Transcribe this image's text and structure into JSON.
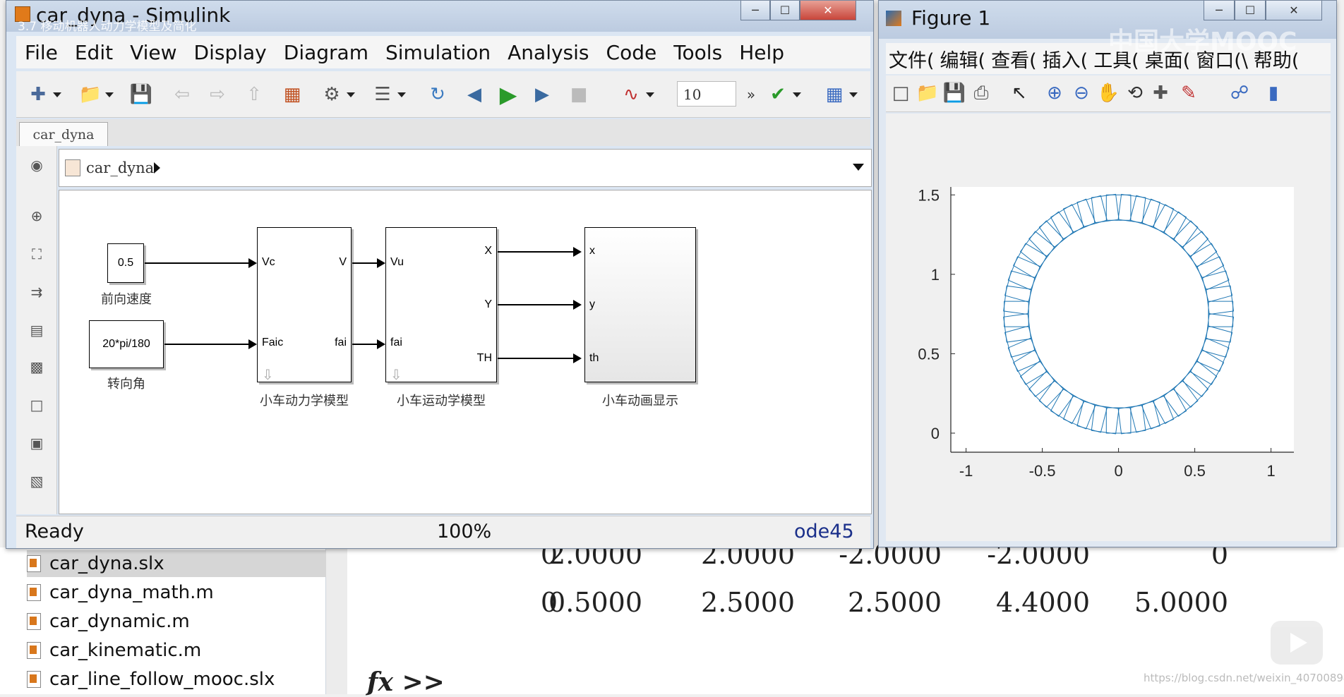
{
  "background": {
    "files": [
      {
        "name": "car_dyna.slx",
        "selected": true
      },
      {
        "name": "car_dyna_math.m",
        "selected": false
      },
      {
        "name": "car_dynamic.m",
        "selected": false
      },
      {
        "name": "car_kinematic.m",
        "selected": false
      },
      {
        "name": "car_line_follow_mooc.slx",
        "selected": false
      }
    ],
    "matrix_rows": [
      [
        "0",
        "2.0000",
        "2.0000",
        "-2.0000",
        "-2.0000",
        "0"
      ],
      [
        "0",
        "0.5000",
        "2.5000",
        "2.5000",
        "4.4000",
        "5.0000"
      ]
    ],
    "prompt": "fx >>",
    "watermark": "https://blog.csdn.net/weixin_40700894",
    "mooc_logo": "中国大学MOOC"
  },
  "simulink": {
    "title": "car_dyna - Simulink",
    "overlay_subtitle": "3.7 移动机器人动力学模型及简化",
    "menus": [
      "File",
      "Edit",
      "View",
      "Display",
      "Diagram",
      "Simulation",
      "Analysis",
      "Code",
      "Tools",
      "Help"
    ],
    "stop_time": "10",
    "tab": "car_dyna",
    "breadcrumb": "car_dyna",
    "status": {
      "state": "Ready",
      "zoom": "100%",
      "solver": "ode45"
    },
    "blocks": {
      "speed_const": {
        "value": "0.5",
        "caption": "前向速度"
      },
      "steer_const": {
        "value": "20*pi/180",
        "caption": "转向角"
      },
      "dynamics": {
        "in1": "Vc",
        "in2": "Faic",
        "out1": "V",
        "out2": "fai",
        "caption": "小车动力学模型"
      },
      "kinematics": {
        "in1": "Vu",
        "in2": "fai",
        "out1": "X",
        "out2": "Y",
        "out3": "TH",
        "caption": "小车运动学模型"
      },
      "animation": {
        "in1": "x",
        "in2": "y",
        "in3": "th",
        "caption": "小车动画显示"
      }
    }
  },
  "figure": {
    "title": "Figure 1",
    "menus": [
      "文件(",
      "编辑(",
      "查看(",
      "插入(",
      "工具(",
      "桌面(",
      "窗口(\\",
      "帮助("
    ],
    "line_color": "#1f77b4"
  },
  "chart_data": {
    "type": "line",
    "title": "",
    "xlabel": "",
    "ylabel": "",
    "xlim": [
      -1.1,
      1.15
    ],
    "ylim": [
      -0.12,
      1.55
    ],
    "xticks": [
      "-1",
      "-0.5",
      "0",
      "0.5",
      "1"
    ],
    "yticks": [
      "0",
      "0.5",
      "1",
      "1.5"
    ],
    "series": [
      {
        "shape": "rotating squares along circle",
        "center": [
          0,
          0.75
        ],
        "radius": 0.67,
        "square_side": 0.16,
        "count": 48
      }
    ]
  }
}
